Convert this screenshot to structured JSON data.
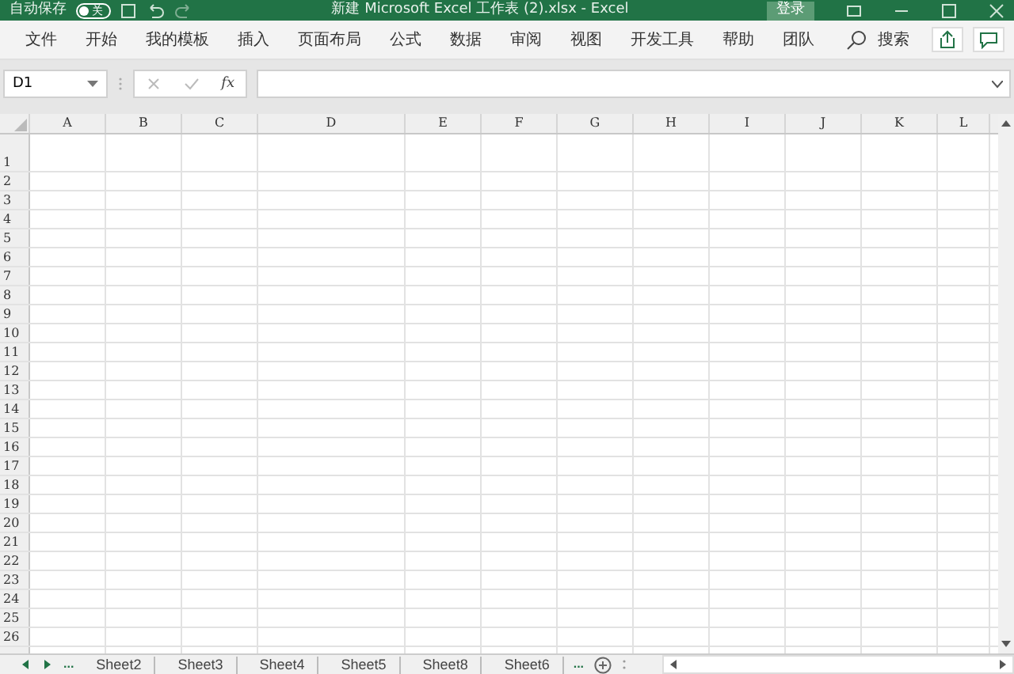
{
  "title_bar": {
    "autosave_label": "自动保存",
    "autosave_toggle": {
      "label": "关",
      "on": false
    },
    "title": "新建 Microsoft Excel 工作表 (2).xlsx  -  Excel",
    "login": "登录"
  },
  "ribbon_tabs": [
    {
      "label": "文件",
      "selected": false
    },
    {
      "label": "开始",
      "selected": false
    },
    {
      "label": "我的模板",
      "selected": false
    },
    {
      "label": "插入",
      "selected": false
    },
    {
      "label": "页面布局",
      "selected": false
    },
    {
      "label": "公式",
      "selected": false
    },
    {
      "label": "数据",
      "selected": false
    },
    {
      "label": "审阅",
      "selected": false
    },
    {
      "label": "视图",
      "selected": false
    },
    {
      "label": "开发工具",
      "selected": false
    },
    {
      "label": "帮助",
      "selected": false
    },
    {
      "label": "团队",
      "selected": false
    }
  ],
  "search": {
    "placeholder": "搜索"
  },
  "formula_bar": {
    "name_box": "D1",
    "fx": "fx"
  },
  "columns": [
    {
      "label": "A",
      "kind": "normal"
    },
    {
      "label": "B",
      "kind": "normal"
    },
    {
      "label": "C",
      "kind": "normal"
    },
    {
      "label": "D",
      "kind": "wide"
    },
    {
      "label": "E",
      "kind": "normal"
    },
    {
      "label": "F",
      "kind": "normal"
    },
    {
      "label": "G",
      "kind": "normal"
    },
    {
      "label": "H",
      "kind": "normal"
    },
    {
      "label": "I",
      "kind": "normal"
    },
    {
      "label": "J",
      "kind": "normal"
    },
    {
      "label": "K",
      "kind": "normal"
    },
    {
      "label": "L",
      "kind": "cut"
    }
  ],
  "rows": [
    "1",
    "2",
    "3",
    "4",
    "5",
    "6",
    "7",
    "8",
    "9",
    "10",
    "11",
    "12",
    "13",
    "14",
    "15",
    "16",
    "17",
    "18",
    "19",
    "20",
    "21",
    "22",
    "23",
    "24",
    "25",
    "26"
  ],
  "sheet_tabs": [
    {
      "label": "Sheet2",
      "selected": false
    },
    {
      "label": "Sheet3",
      "selected": false
    },
    {
      "label": "Sheet4",
      "selected": false
    },
    {
      "label": "Sheet5",
      "selected": false
    },
    {
      "label": "Sheet8",
      "selected": false
    },
    {
      "label": "Sheet6",
      "selected": false
    }
  ],
  "sheet_nav": {
    "more_left": "...",
    "more_right": "..."
  }
}
